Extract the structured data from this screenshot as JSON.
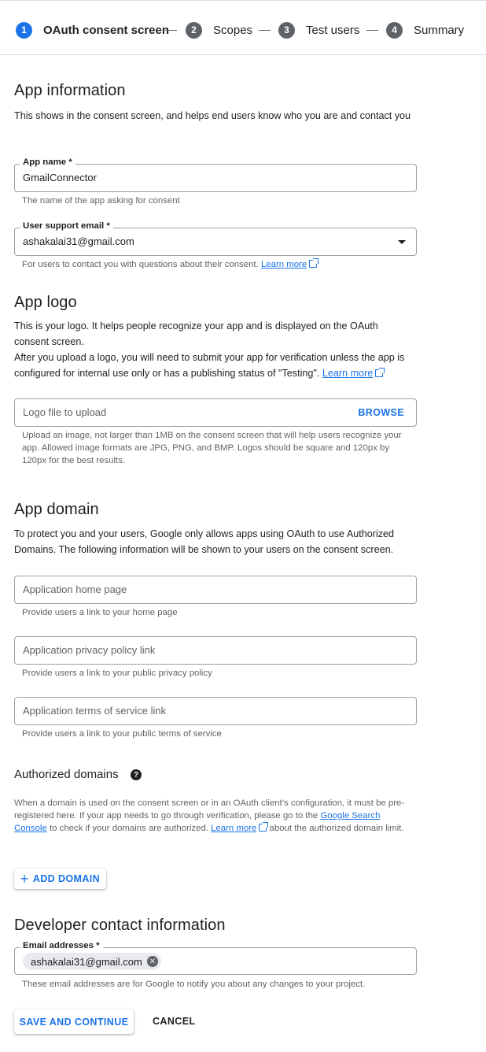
{
  "stepper": {
    "steps": [
      {
        "num": "1",
        "label": "OAuth consent screen"
      },
      {
        "num": "2",
        "label": "Scopes"
      },
      {
        "num": "3",
        "label": "Test users"
      },
      {
        "num": "4",
        "label": "Summary"
      }
    ],
    "active_step": 1
  },
  "app_info": {
    "title": "App information",
    "description": "This shows in the consent screen, and helps end users know who you are and contact you",
    "app_name": {
      "label": "App name *",
      "value": "GmailConnector",
      "help": "The name of the app asking for consent"
    },
    "support_email": {
      "label": "User support email *",
      "value": "ashakalai31@gmail.com",
      "help": "For users to contact you with questions about their consent.",
      "learn_more": "Learn more"
    }
  },
  "app_logo": {
    "title": "App logo",
    "description_1": "This is your logo. It helps people recognize your app and is displayed on the OAuth consent screen.",
    "description_2": "After you upload a logo, you will need to submit your app for verification unless the app is configured for internal use only or has a publishing status of \"Testing\".",
    "learn_more": "Learn more",
    "upload_placeholder": "Logo file to upload",
    "browse_label": "BROWSE",
    "help": "Upload an image, not larger than 1MB on the consent screen that will help users recognize your app. Allowed image formats are JPG, PNG, and BMP. Logos should be square and 120px by 120px for the best results."
  },
  "app_domain": {
    "title": "App domain",
    "description": "To protect you and your users, Google only allows apps using OAuth to use Authorized Domains. The following information will be shown to your users on the consent screen.",
    "home_page": {
      "placeholder": "Application home page",
      "help": "Provide users a link to your home page"
    },
    "privacy_policy": {
      "placeholder": "Application privacy policy link",
      "help": "Provide users a link to your public privacy policy"
    },
    "terms_of_service": {
      "placeholder": "Application terms of service link",
      "help": "Provide users a link to your public terms of service"
    }
  },
  "authorized_domains": {
    "title": "Authorized domains",
    "help_icon": "help-circle-icon",
    "text_1": "When a domain is used on the consent screen or in an OAuth client’s configuration, it must be pre-registered here. If your app needs to go through verification, please go to the",
    "search_console_link": "Google Search Console",
    "text_2": "to check if your domains are authorized.",
    "learn_more": "Learn more",
    "text_3": "about the authorized domain limit.",
    "add_domain_label": "ADD DOMAIN"
  },
  "developer_contact": {
    "title": "Developer contact information",
    "email_label": "Email addresses *",
    "email_chip": "ashakalai31@gmail.com",
    "help": "These email addresses are for Google to notify you about any changes to your project."
  },
  "actions": {
    "save_label": "SAVE AND CONTINUE",
    "cancel_label": "CANCEL"
  },
  "colors": {
    "primary": "#1a73e8",
    "text": "#202124",
    "secondary_text": "#5f6368",
    "border": "#9aa0a6"
  }
}
